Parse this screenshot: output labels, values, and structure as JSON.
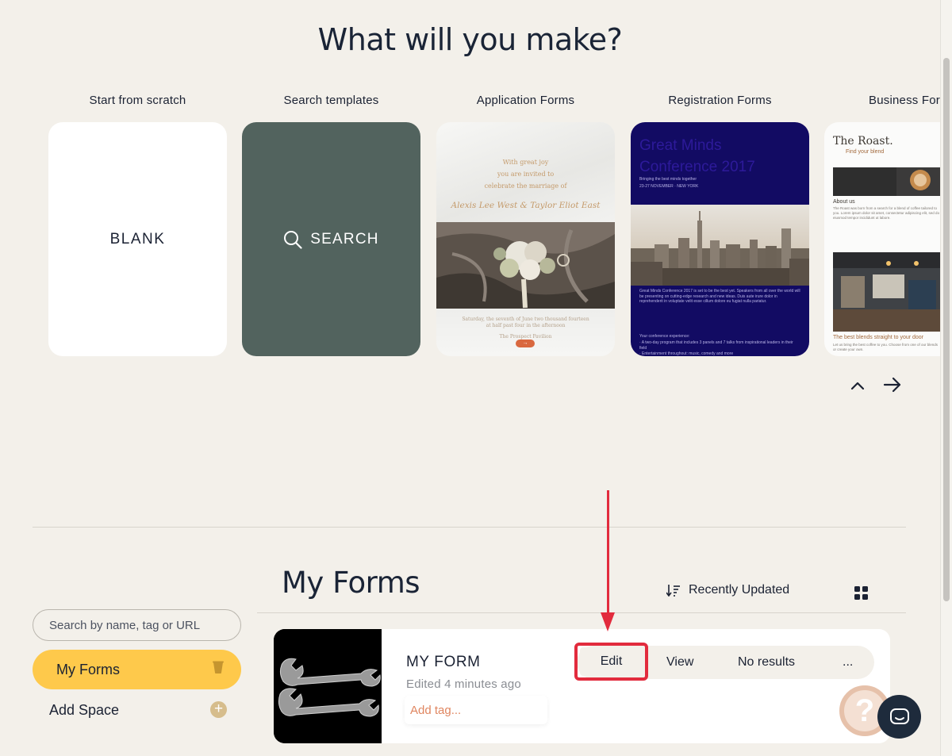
{
  "hero": {
    "title": "What will you make?"
  },
  "templates": [
    {
      "label": "Start from scratch",
      "card_text": "BLANK"
    },
    {
      "label": "Search templates",
      "card_text": "SEARCH"
    },
    {
      "label": "Application Forms",
      "preview": {
        "line1": "With great joy",
        "line2": "you are invited to",
        "line3": "celebrate the marriage of",
        "names": "Alexis Lee West & Taylor Eliot East",
        "footer1": "Saturday, the seventh of June two thousand fourteen",
        "footer2": "at half past four in the afternoon",
        "venue": "The Prospect Pavilion"
      }
    },
    {
      "label": "Registration Forms",
      "preview": {
        "title": "Great Minds Conference 2017",
        "tagline": "Bringing the best minds together",
        "date": "23-27 NOVEMBER · NEW YORK",
        "body": "Great Minds Conference 2017 is set to be the best yet. Speakers from all over the world will be presenting on cutting-edge research and new ideas. Duis aute irure dolor in reprehenderit in voluptate velit esse cillum dolore eu fugiat nulla pariatur.",
        "exp_title": "Your conference experience:",
        "exp1": "· A two-day program that includes 3 panels and 7 talks from inspirational leaders in their field",
        "exp2": "· Entertainment throughout: music, comedy and more"
      }
    },
    {
      "label": "Business Forms",
      "preview": {
        "brand": "The Roast.",
        "sub": "Find your blend",
        "about": "About us",
        "about_body": "The Roast was born from a search for a blend of coffee tailored to you. Lorem ipsum dolor sit amet, consectetur adipiscing elit, sed do eiusmod tempor incididunt ut labore.",
        "best": "The best blends straight to your door",
        "best_body": "Let us bring the best coffee to you. Choose from one of our blends or create your own."
      }
    }
  ],
  "carousel": {
    "up_icon": "chevron-up-icon",
    "next_icon": "arrow-right-icon"
  },
  "sidebar": {
    "search_placeholder": "Search by name, tag or URL",
    "active_item": "My Forms",
    "add_space": "Add Space"
  },
  "forms": {
    "title": "My Forms",
    "sort_label": "Recently Updated",
    "items": [
      {
        "name": "MY FORM",
        "edited": "Edited 4 minutes ago",
        "tag_placeholder": "Add tag...",
        "edit": "Edit",
        "view": "View",
        "results": "No results",
        "more": "..."
      }
    ]
  },
  "colors": {
    "background": "#f3f0ea",
    "accent_yellow": "#fec94b",
    "search_card": "#52635e",
    "annotation_red": "#e22b3d",
    "chat": "#1e2b3c"
  },
  "help": {
    "symbol": "?"
  }
}
